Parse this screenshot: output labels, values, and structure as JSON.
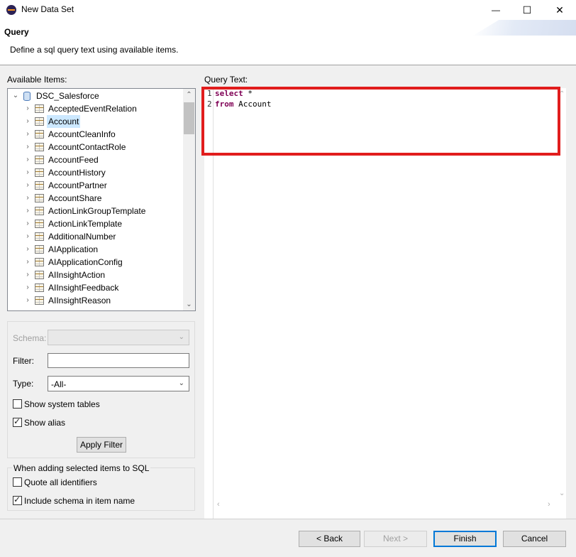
{
  "window": {
    "title": "New Data Set",
    "minimize_glyph": "—",
    "maximize_glyph": "☐",
    "close_glyph": "✕"
  },
  "header": {
    "title": "Query",
    "description": "Define a sql query text using available items."
  },
  "available_items": {
    "label": "Available Items:",
    "root": "DSC_Salesforce",
    "selected": "Account",
    "items": [
      "AcceptedEventRelation",
      "Account",
      "AccountCleanInfo",
      "AccountContactRole",
      "AccountFeed",
      "AccountHistory",
      "AccountPartner",
      "AccountShare",
      "ActionLinkGroupTemplate",
      "ActionLinkTemplate",
      "AdditionalNumber",
      "AIApplication",
      "AIApplicationConfig",
      "AIInsightAction",
      "AIInsightFeedback",
      "AIInsightReason"
    ]
  },
  "filters": {
    "schema_label": "Schema:",
    "schema_value": "",
    "filter_label": "Filter:",
    "filter_value": "",
    "type_label": "Type:",
    "type_value": "-All-",
    "show_system_tables": {
      "label": "Show system tables",
      "checked": false
    },
    "show_alias": {
      "label": "Show alias",
      "checked": true
    },
    "apply_filter_label": "Apply Filter"
  },
  "sql_options": {
    "title": "When adding selected items to SQL",
    "quote_identifiers": {
      "label": "Quote all identifiers",
      "checked": false
    },
    "include_schema": {
      "label": "Include schema in item name",
      "checked": true
    }
  },
  "query": {
    "label": "Query Text:",
    "lines": [
      {
        "num": "1",
        "keyword": "select",
        "rest": " *"
      },
      {
        "num": "2",
        "keyword": "from",
        "rest": " Account"
      }
    ]
  },
  "buttons": {
    "back": "< Back",
    "next": "Next >",
    "finish": "Finish",
    "cancel": "Cancel"
  },
  "colors": {
    "highlight": "#e11d1d",
    "keyword": "#7f0055",
    "selection": "#cce8ff"
  }
}
